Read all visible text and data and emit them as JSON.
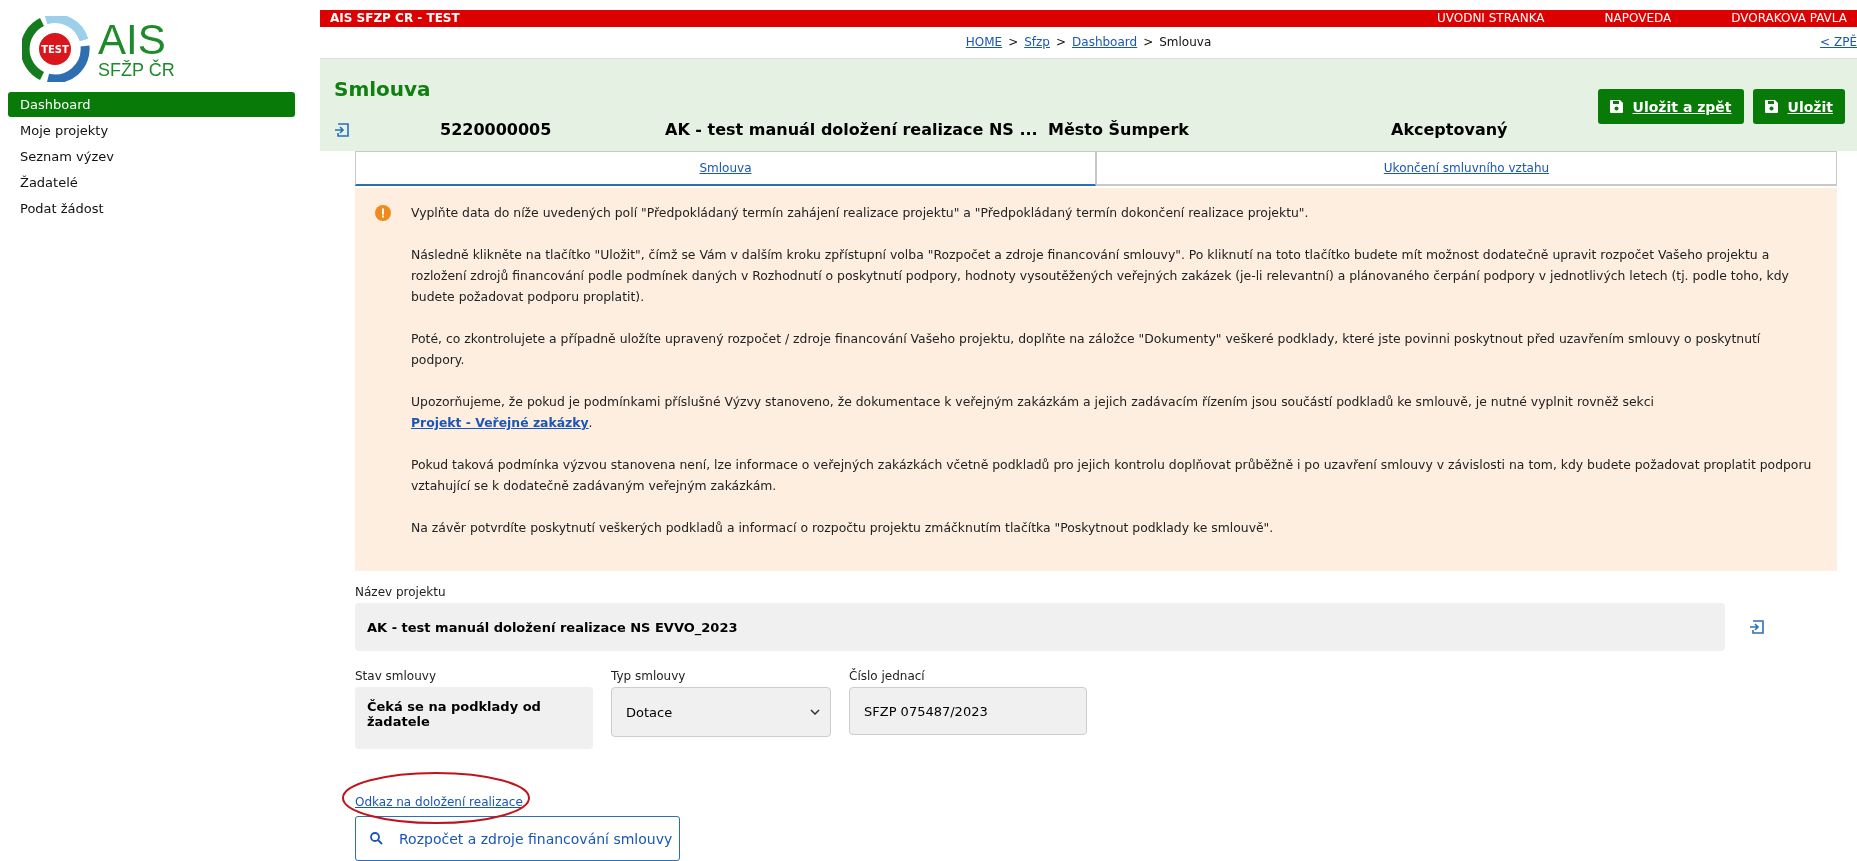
{
  "logo": {
    "badge": "TEST",
    "title": "AIS",
    "subtitle": "SFŽP ČR"
  },
  "sidebar": {
    "items": [
      {
        "label": "Dashboard",
        "selected": true
      },
      {
        "label": "Moje projekty",
        "selected": false
      },
      {
        "label": "Seznam výzev",
        "selected": false
      },
      {
        "label": "Žadatelé",
        "selected": false
      },
      {
        "label": "Podat žádost",
        "selected": false
      }
    ]
  },
  "top_bar": {
    "title": "AIS SFZP CR - TEST",
    "links": [
      "UVODNI STRANKA",
      "NAPOVEDA",
      "DVORAKOVA PAVLA"
    ]
  },
  "breadcrumb": {
    "items": [
      {
        "label": "HOME",
        "link": true
      },
      {
        "label": "Sfzp",
        "link": true
      },
      {
        "label": "Dashboard",
        "link": true
      },
      {
        "label": "Smlouva",
        "link": false
      }
    ],
    "separator": ">",
    "back_link": "< ZPĚ"
  },
  "header": {
    "title": "Smlouva",
    "buttons": [
      "Uložit a zpět",
      "Uložit"
    ],
    "summary": [
      "5220000005",
      "AK - test manuál doložení realizace NS ...",
      "Město Šumperk",
      "Akceptovaný"
    ]
  },
  "tabs": [
    {
      "label": "Smlouva",
      "selected": true
    },
    {
      "label": "Ukončení smluvního vztahu",
      "selected": false
    }
  ],
  "info": {
    "paragraphs": [
      {
        "text": "Vyplňte data do níže uvedených polí \"Předpokládaný termín zahájení realizace projektu\" a \"Předpokládaný termín dokončení realizace projektu\"."
      },
      {
        "text": "Následně klikněte na tlačítko \"Uložit\", čímž se Vám v dalším kroku zpřístupní volba \"Rozpočet a zdroje financování smlouvy\". Po kliknutí na toto tlačítko budete mít možnost dodatečně upravit rozpočet Vašeho projektu a rozložení zdrojů financování podle podmínek daných v Rozhodnutí o poskytnutí podpory, hodnoty vysoutěžených veřejných zakázek (je-li relevantní) a plánovaného čerpání podpory v jednotlivých letech (tj. podle toho, kdy budete požadovat podporu proplatit)."
      },
      {
        "text": "Poté, co zkontrolujete a případně uložíte upravený rozpočet / zdroje financování Vašeho projektu, doplňte na záložce \"Dokumenty\" veškeré podklady, které jste povinni poskytnout před uzavřením smlouvy o poskytnutí podpory."
      },
      {
        "text": "Upozorňujeme, že pokud je podmínkami příslušné Výzvy stanoveno, že dokumentace k veřejným zakázkám a jejich zadávacím řízením jsou součástí podkladů ke smlouvě, je nutné vyplnit rovněž sekci",
        "link": "Projekt - Veřejné zakázky",
        "after": "."
      },
      {
        "text": "Pokud taková podmínka výzvou stanovena není, lze informace o veřejných zakázkách včetně podkladů pro jejich kontrolu doplňovat průběžně i po uzavření smlouvy v závislosti na tom, kdy budete požadovat proplatit podporu vztahující se k dodatečně zadávaným veřejným zakázkám."
      },
      {
        "text": "Na závěr potvrdíte poskytnutí veškerých podkladů a informací o rozpočtu projektu zmáčknutím tlačítka \"Poskytnout podklady ke smlouvě\"."
      }
    ]
  },
  "form": {
    "project_name": {
      "label": "Název projektu",
      "value": "AK - test manuál doložení realizace NS EVVO_2023"
    },
    "fields": [
      {
        "kind": "readonly",
        "label": "Stav smlouvy",
        "value": "Čeká se na podklady od žadatele"
      },
      {
        "kind": "select",
        "label": "Typ smlouvy",
        "value": "Dotace"
      },
      {
        "kind": "input",
        "label": "Číslo jednací",
        "value": "SFZP 075487/2023"
      }
    ],
    "link": "Odkaz na doložení realizace",
    "button": "Rozpočet a zdroje financování smlouvy"
  },
  "highlight": {
    "kind": "ellipse"
  }
}
